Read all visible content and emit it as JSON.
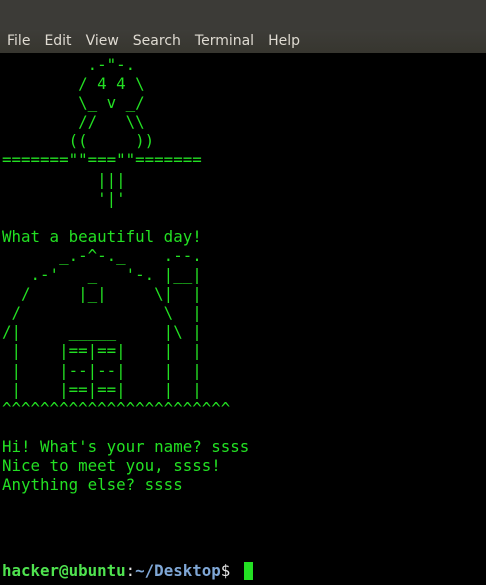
{
  "menubar": {
    "items": [
      "File",
      "Edit",
      "View",
      "Search",
      "Terminal",
      "Help"
    ]
  },
  "terminal": {
    "output": "         .-\"-.\n        / 4 4 \\\n        \\_ v _/\n        //   \\\\\n       ((     ))\n=======\"\"===\"\"=======\n          |||\n          '|'\n\nWhat a beautiful day!\n      _.-^-._    .--.\n   .-'   _   '-. |__|\n  /     |_|     \\|  |\n /               \\  |\n/|     _____     |\\ |\n |    |==|==|    |  |\n |    |--|--|    |  |\n |    |==|==|    |  |\n^^^^^^^^^^^^^^^^^^^^^^^^\n\nHi! What's your name? ssss\nNice to meet you, ssss!\nAnything else? ssss",
    "prompt": {
      "user_host": "hacker@ubuntu",
      "separator": ":",
      "path": "~/Desktop",
      "symbol": "$ "
    }
  },
  "colors": {
    "terminal_text": "#23e023",
    "terminal_bg": "#000000",
    "menubar_bg": "#3c3b37",
    "menu_text": "#dfdbd2",
    "prompt_user": "#4fe24f",
    "prompt_path": "#7fa7d6"
  }
}
